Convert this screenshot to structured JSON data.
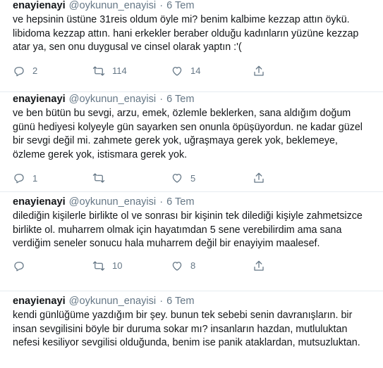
{
  "tweets": [
    {
      "display_name": "enayienayi",
      "handle": "@oykunun_enayisi",
      "separator": "·",
      "date": "6 Tem",
      "text": "ve hepsinin üstüne 31reis oldum öyle mi? benim kalbime kezzap attın öykü. libidoma kezzap attın. hani erkekler beraber olduğu kadınların yüzüne kezzap atar ya, sen onu duygusal ve cinsel olarak yaptın :'(",
      "replies": "2",
      "retweets": "114",
      "likes": "14"
    },
    {
      "display_name": "enayienayi",
      "handle": "@oykunun_enayisi",
      "separator": "·",
      "date": "6 Tem",
      "text": "ve ben bütün bu sevgi, arzu, emek, özlemle beklerken, sana aldığım doğum günü hediyesi kolyeyle gün sayarken sen onunla öpüşüyordun. ne kadar güzel bir sevgi değil mi. zahmete gerek yok, uğraşmaya gerek yok, beklemeye, özleme gerek yok, istismara gerek yok.",
      "replies": "1",
      "retweets": "",
      "likes": "5"
    },
    {
      "display_name": "enayienayi",
      "handle": "@oykunun_enayisi",
      "separator": "·",
      "date": "6 Tem",
      "text": "dilediğin kişilerle birlikte ol ve sonrası bir kişinin tek dilediği kişiyle zahmetsizce birlikte ol. muharrem olmak için hayatımdan 5 sene verebilirdim ama sana verdiğim seneler sonucu hala muharrem değil bir enayiyim maalesef.",
      "replies": "",
      "retweets": "10",
      "likes": "8"
    },
    {
      "display_name": "enayienayi",
      "handle": "@oykunun_enayisi",
      "separator": "·",
      "date": "6 Tem",
      "text": "kendi günlüğüme yazdığım bir şey. bunun tek sebebi senin davranışların. bir insan sevgilisini böyle bir duruma sokar mı? insanların hazdan, mutluluktan nefesi kesiliyor sevgilisi olduğunda, benim ise panik ataklardan, mutsuzluktan."
    }
  ]
}
